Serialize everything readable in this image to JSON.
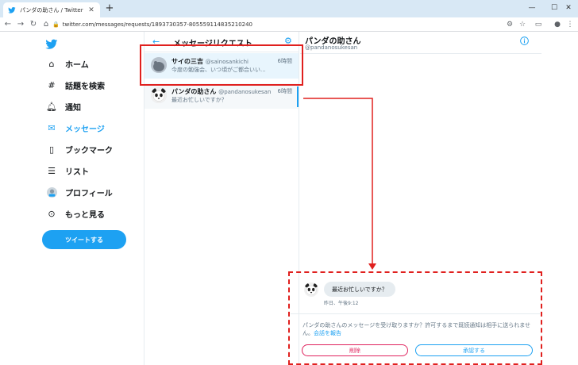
{
  "browser": {
    "tab_title": "パンダの助さん / Twitter",
    "url": "twitter.com/messages/requests/1893730357-805559114835210240"
  },
  "nav": {
    "items": [
      {
        "label": "ホーム"
      },
      {
        "label": "話題を検索"
      },
      {
        "label": "通知"
      },
      {
        "label": "メッセージ"
      },
      {
        "label": "ブックマーク"
      },
      {
        "label": "リスト"
      },
      {
        "label": "プロフィール"
      },
      {
        "label": "もっと見る"
      }
    ],
    "tweet_button": "ツイートする"
  },
  "requests": {
    "title": "メッセージリクエスト",
    "items": [
      {
        "name": "サイの三吉",
        "handle": "@sainosankichi",
        "time": "6時間",
        "preview": "今度の勉強会、いつ頃がご都合いい..."
      },
      {
        "name": "パンダの助さん",
        "handle": "@pandanosukesan",
        "time": "6時間",
        "preview": "最近お忙しいですか？"
      }
    ]
  },
  "conversation": {
    "name": "パンダの助さん",
    "handle": "@pandanosukesan",
    "message": "最近お忙しいですか？",
    "message_time": "昨日、午後9:12",
    "notice": "パンダの助さんのメッセージを受け取りますか？許可するまで既読通知は相手に送られません。",
    "report_link": "会話を報告",
    "delete_button": "削除",
    "accept_button": "承認する"
  },
  "colors": {
    "accent": "#1da1f2",
    "delete": "#e0245e",
    "annotation": "#e0201e"
  }
}
